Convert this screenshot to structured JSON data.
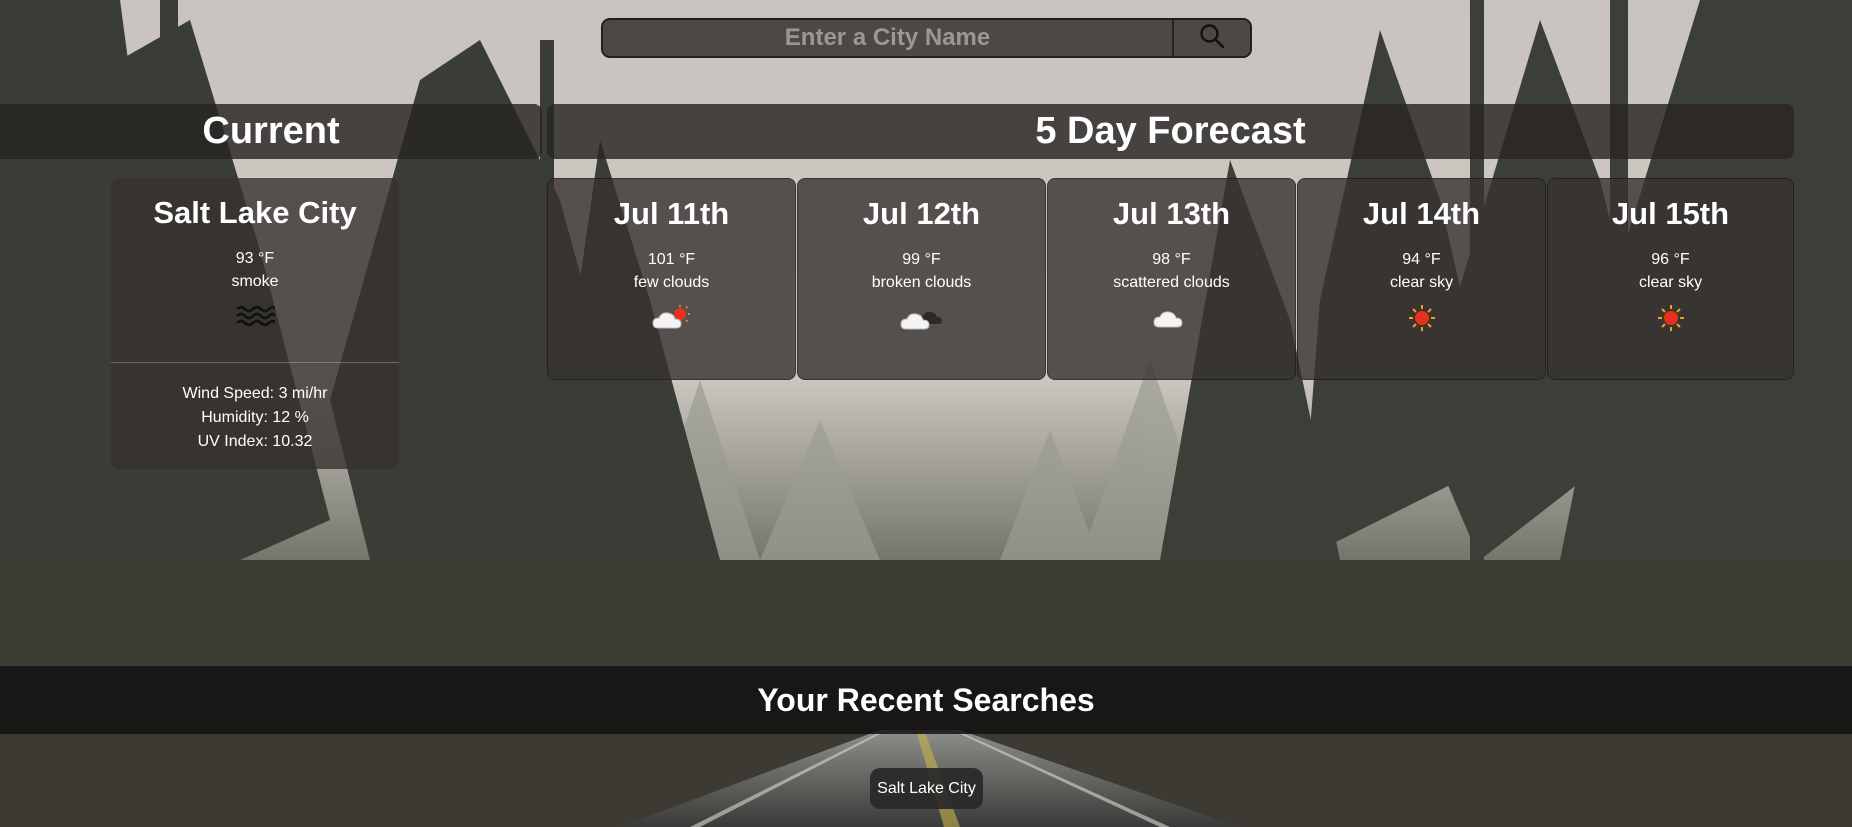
{
  "search": {
    "placeholder": "Enter a City Name",
    "value": "",
    "button_icon": "search-icon"
  },
  "headers": {
    "current": "Current",
    "forecast": "5 Day Forecast",
    "recent": "Your Recent Searches"
  },
  "current": {
    "city": "Salt Lake City",
    "temp": "93 °F",
    "description": "smoke",
    "icon": "smoke-icon",
    "wind": "Wind Speed: 3 mi/hr",
    "humidity": "Humidity: 12 %",
    "uv": "UV Index: 10.32"
  },
  "forecast": [
    {
      "date": "Jul 11th",
      "temp": "101 °F",
      "description": "few clouds",
      "icon": "few-clouds-icon"
    },
    {
      "date": "Jul 12th",
      "temp": "99 °F",
      "description": "broken clouds",
      "icon": "broken-clouds-icon"
    },
    {
      "date": "Jul 13th",
      "temp": "98 °F",
      "description": "scattered clouds",
      "icon": "scattered-clouds-icon"
    },
    {
      "date": "Jul 14th",
      "temp": "94 °F",
      "description": "clear sky",
      "icon": "sun-icon"
    },
    {
      "date": "Jul 15th",
      "temp": "96 °F",
      "description": "clear sky",
      "icon": "sun-icon"
    }
  ],
  "recent_searches": [
    "Salt Lake City"
  ],
  "colors": {
    "panel": "#373230",
    "header": "#282523",
    "recent_header": "#121212",
    "sun": "#e8311a"
  }
}
